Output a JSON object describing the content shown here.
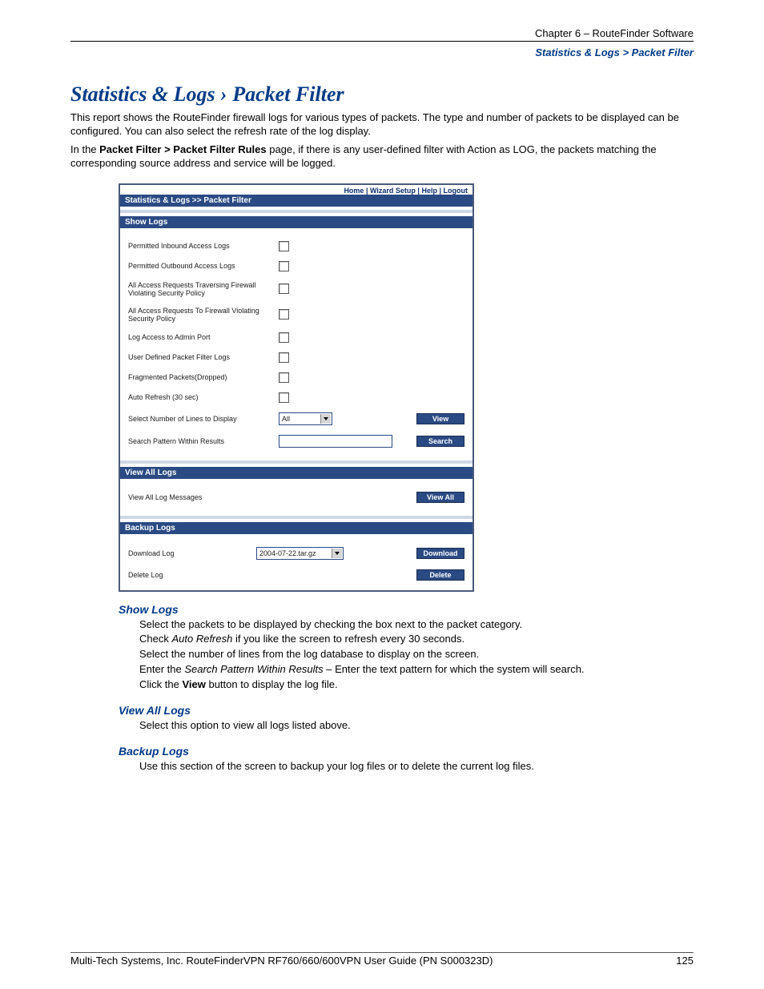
{
  "header": {
    "chapter": "Chapter 6 – RouteFinder Software",
    "breadcrumb": "Statistics & Logs > Packet Filter"
  },
  "title_parts": {
    "a": "Statistics & Logs",
    "sep": " › ",
    "b": "Packet Filter"
  },
  "paras": {
    "p1": "This report shows the RouteFinder firewall logs for various types of packets. The type and number of packets to be displayed can be configured. You can also select the refresh rate of the log display.",
    "p2a": "In the ",
    "p2b": "Packet Filter > Packet Filter Rules",
    "p2c": " page, if there is any user-defined filter with Action as LOG, the packets matching the corresponding source address and service will be logged."
  },
  "panel": {
    "nav": {
      "home": "Home",
      "wizard": "Wizard Setup",
      "help": "Help",
      "logout": "Logout",
      "sep": " | "
    },
    "title_bar": "Statistics & Logs >> Packet Filter",
    "bar_show": "Show Logs",
    "rows": {
      "r1": "Permitted Inbound Access Logs",
      "r2": "Permitted Outbound Access Logs",
      "r3": "All Access Requests Traversing Firewall Violating Security Policy",
      "r4": "All Access Requests To Firewall Violating Security Policy",
      "r5": "Log Access to Admin Port",
      "r6": "User Defined Packet Filter Logs",
      "r7": "Fragmented Packets(Dropped)",
      "r8": "Auto Refresh (30 sec)",
      "r9": "Select Number of Lines to Display",
      "r9_sel": "All",
      "r10": "Search Pattern Within Results"
    },
    "btn_view": "View",
    "btn_search": "Search",
    "bar_viewall": "View All Logs",
    "viewall_label": "View All Log Messages",
    "btn_viewall": "View All",
    "bar_backup": "Backup Logs",
    "download_label": "Download Log",
    "download_sel": "2004-07-22.tar.gz",
    "btn_download": "Download",
    "delete_label": "Delete Log",
    "btn_delete": "Delete"
  },
  "sections": {
    "show_head": "Show Logs",
    "show_l1": "Select the packets to be displayed by checking the box next to the packet category.",
    "show_l2a": "Check ",
    "show_l2b": "Auto Refresh",
    "show_l2c": " if you like the screen to refresh every 30 seconds.",
    "show_l3": "Select the number of lines from the log database to display on the screen.",
    "show_l4a": "Enter the ",
    "show_l4b": "Search Pattern Within Results",
    "show_l4c": " – Enter the text pattern for which the system will search.",
    "show_l5a": "Click the ",
    "show_l5b": "View",
    "show_l5c": " button to display the log file.",
    "viewall_head": "View All Logs",
    "viewall_body": "Select this option to view all logs listed above.",
    "backup_head": "Backup Logs",
    "backup_body": "Use this section of the screen to backup your log files or to delete the current log files."
  },
  "footer": {
    "left": "Multi-Tech Systems, Inc. RouteFinderVPN RF760/660/600VPN User Guide (PN S000323D)",
    "right": "125"
  }
}
